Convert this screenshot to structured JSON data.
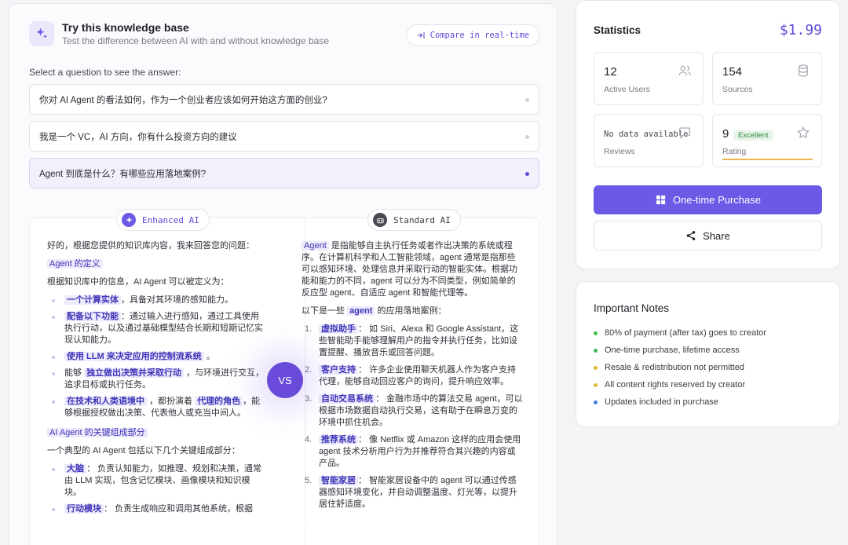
{
  "kb": {
    "title": "Try this knowledge base",
    "subtitle": "Test the difference between AI with and without knowledge base",
    "compare_label": "Compare in real-time",
    "select_label": "Select a question to see the answer:"
  },
  "questions": [
    {
      "text": "你对 AI Agent 的看法如何，作为一个创业者应该如何开始这方面的创业?"
    },
    {
      "text": "我是一个 VC，AI 方向，你有什么投资方向的建议"
    },
    {
      "text": "Agent 到底是什么？有哪些应用落地案例?"
    }
  ],
  "compare": {
    "enhanced_label": "Enhanced AI",
    "standard_label": "Standard AI",
    "vs_label": "VS"
  },
  "enhanced": {
    "intro": "好的，根据您提供的知识库内容，我来回答您的问题：",
    "h1": "Agent 的定义",
    "p1": "根据知识库中的信息，AI Agent 可以被定义为：",
    "b1_hl": "一个计算实体",
    "b1_rest": "，具备对其环境的感知能力。",
    "b2_hl": "配备以下功能",
    "b2_rest": "：通过输入进行感知，通过工具使用执行行动，以及通过基础模型结合长期和短期记忆实现认知能力。",
    "b3_hl": "使用 LLM 来决定应用的控制流系统",
    "b3_rest": " 。",
    "b4_pre": "能够 ",
    "b4_hl": "独立做出决策并采取行动",
    "b4_rest": " ，与环境进行交互，追求目标或执行任务。",
    "b5_hl": "在技术和人类语境中",
    "b5_mid": " ，都扮演着 ",
    "b5_hl2": "代理的角色",
    "b5_rest": "，能够根据授权做出决策、代表他人或充当中间人。",
    "h2": "AI Agent 的关键组成部分",
    "p2": "一个典型的 AI Agent 包括以下几个关键组成部分：",
    "c1_hl": "大脑",
    "c1_rest": "： 负责认知能力，如推理、规划和决策，通常由 LLM 实现，包含记忆模块、画像模块和知识模块。",
    "c2_hl": "行动模块",
    "c2_rest": "： 负责生成响应和调用其他系统，根据"
  },
  "standard": {
    "p1_hl": "Agent",
    "p1_rest": " 是指能够自主执行任务或者作出决策的系统或程序。在计算机科学和人工智能领域，agent 通常是指那些可以感知环境、处理信息并采取行动的智能实体。根据功能和能力的不同，agent 可以分为不同类型，例如简单的反应型 agent、自适应 agent 和智能代理等。",
    "p2_pre": "以下是一些 ",
    "p2_hl": "agent",
    "p2_rest": " 的应用落地案例：",
    "items": [
      {
        "num": "1.",
        "hl": "虚拟助手",
        "rest": "： 如 Siri、Alexa 和 Google Assistant，这些智能助手能够理解用户的指令并执行任务，比如设置提醒、播放音乐或回答问题。"
      },
      {
        "num": "2.",
        "hl": "客户支持",
        "rest": "： 许多企业使用聊天机器人作为客户支持代理，能够自动回应客户的询问，提升响应效率。"
      },
      {
        "num": "3.",
        "hl": "自动交易系统",
        "rest": "： 金融市场中的算法交易 agent，可以根据市场数据自动执行交易，这有助于在瞬息万变的环境中抓住机会。"
      },
      {
        "num": "4.",
        "hl": "推荐系统",
        "rest": "： 像 Netflix 或 Amazon 这样的应用会使用 agent 技术分析用户行为并推荐符合其兴趣的内容或产品。"
      },
      {
        "num": "5.",
        "hl": "智能家居",
        "rest": "： 智能家居设备中的 agent 可以通过传感器感知环境变化，并自动调整温度、灯光等，以提升居住舒适度。"
      }
    ]
  },
  "stats": {
    "title": "Statistics",
    "price": "$1.99",
    "active_users": {
      "value": "12",
      "label": "Active Users"
    },
    "sources": {
      "value": "154",
      "label": "Sources"
    },
    "reviews": {
      "value": "No data available",
      "label": "Reviews"
    },
    "rating": {
      "value": "9",
      "badge": "Excellent",
      "label": "Rating"
    },
    "purchase_label": "One-time Purchase",
    "share_label": "Share",
    "accent": "#6a5ae6"
  },
  "notes": {
    "title": "Important Notes",
    "items": [
      {
        "text": "80% of payment (after tax) goes to creator",
        "color": "#3fb950"
      },
      {
        "text": "One-time purchase, lifetime access",
        "color": "#3fb950"
      },
      {
        "text": "Resale & redistribution not permitted",
        "color": "#e0b93a"
      },
      {
        "text": "All content rights reserved by creator",
        "color": "#e0b93a"
      },
      {
        "text": "Updates included in purchase",
        "color": "#4b7be5"
      }
    ]
  }
}
